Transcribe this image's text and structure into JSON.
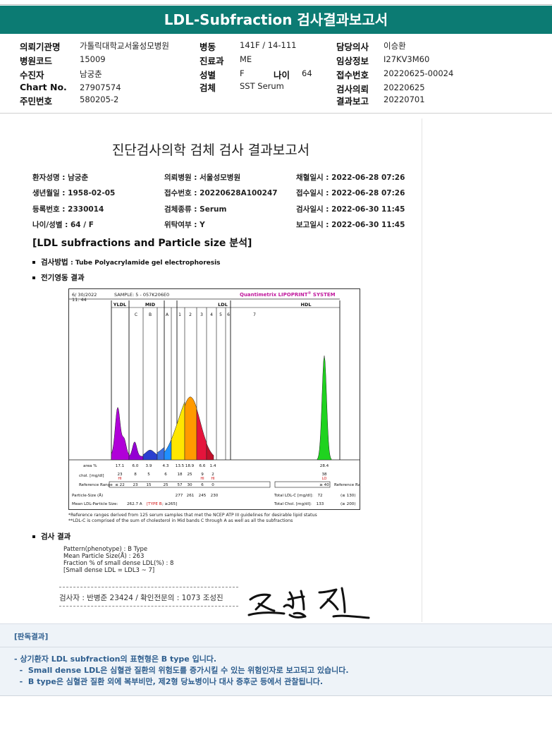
{
  "title": "LDL-Subfraction 검사결과보고서",
  "header": {
    "rows": [
      [
        {
          "label": "의뢰기관명",
          "value": "가톨릭대학교서울성모병원"
        },
        {
          "label": "병동",
          "value": "141F / 14-111"
        },
        {
          "label": "담당의사",
          "value": "이승환"
        }
      ],
      [
        {
          "label": "병원코드",
          "value": "15009"
        },
        {
          "label": "진료과",
          "value": "ME"
        },
        {
          "label": "임상정보",
          "value": "I27KV3M60"
        }
      ],
      [
        {
          "label": "수진자",
          "value": "남궁춘"
        },
        {
          "label": "성별",
          "value": "F"
        },
        {
          "label": "접수번호",
          "value": "20220625-00024"
        }
      ],
      [
        {
          "label": "Chart No.",
          "value": "27907574"
        },
        {
          "label": "검체",
          "value": "SST Serum"
        },
        {
          "label": "검사의뢰",
          "value": "20220625"
        }
      ],
      [
        {
          "label": "주민번호",
          "value": "580205-2"
        },
        null,
        {
          "label": "결과보고",
          "value": "20220701"
        }
      ]
    ],
    "age_label": "나이",
    "age_value": "64"
  },
  "report": {
    "title": "진단검사의학 검체 검사 결과보고서",
    "patient_info": [
      [
        "환자성명 : 남궁춘",
        "의뢰병원 : 서울성모병원",
        "채혈일시 : 2022-06-28 07:26"
      ],
      [
        "생년월일 : 1958-02-05",
        "접수번호 : 20220628A100247",
        "접수일시 : 2022-06-28 07:26"
      ],
      [
        "등록번호 : 2330014",
        "검체종류 : Serum",
        "검사일시 : 2022-06-30 11:45"
      ],
      [
        "나이/성별 : 64 / F",
        "위탁여부 :  Y",
        "보고일시 : 2022-06-30 11:45"
      ]
    ],
    "section_title": "[LDL subfractions and Particle size 분석]",
    "method_label": "검사방법",
    "method_value": ": Tube Polyacrylamide gel electrophoresis",
    "electro_label": "전기영동 결과",
    "result_label": "검사 결과",
    "results": [
      "Pattern(phenotype) : B Type",
      "Mean Particle Size(Å) : 263",
      "Fraction % of small dense LDL(%) : 8",
      "[Small dense LDL = LDL3 ~ 7]"
    ],
    "notes": [
      "*Reference ranges derived from 125 serum samples that met the NCEP ATP III guidelines for desirable lipid status",
      "**LDL-C is comprised of the sum of cholesterol in Mid bands C through A as well as all the subfractions"
    ],
    "checker": "검사자 : 반병준  23424  /  확인전문의 : 1073  조성진",
    "signature_text": "조성진"
  },
  "chart_data": {
    "type": "area",
    "date": "6/ 30/2022",
    "time": "11: 44",
    "sample": "SAMPLE:   5 - 057K206E0",
    "brand": "Quantimetrix LIPOPRINT",
    "brand_sup": "®",
    "brand_tail": " SYSTEM",
    "groups": [
      "YLDL",
      "MID",
      "LDL",
      "HDL"
    ],
    "bands": [
      "C",
      "B",
      "A",
      "1",
      "2",
      "3",
      "4",
      "5",
      "6",
      "7"
    ],
    "row_labels": {
      "area": "area %",
      "chol": "chol. [mg/dl]",
      "ref": "Reference Range",
      "ref_right": "Reference Range",
      "size": "Particle-Size (Å)",
      "mean": "Mean LDL-Particle Size:"
    },
    "area_pct": [
      "17.1",
      "6.0",
      "3.9",
      "4.3",
      "13.5",
      "18.9",
      "6.6",
      "1.4"
    ],
    "hdl_area": "28.4",
    "chol": [
      "23",
      "8",
      "5",
      "6",
      "18",
      "25",
      "9",
      "2"
    ],
    "chol_flags": [
      "HI",
      "",
      "",
      "",
      "",
      "",
      "HI",
      "HI"
    ],
    "hdl_chol": "38",
    "hdl_flag": "LO",
    "reference": [
      "≤ 22",
      "23",
      "15",
      "25",
      "57",
      "30",
      "6",
      "0"
    ],
    "hdl_reference": "≥ 40",
    "particle_size": [
      "277",
      "261",
      "245",
      "230"
    ],
    "mean_size_value": "262.7 A",
    "mean_size_type": "[TYPE B",
    "mean_size_ref": "; ≥265]",
    "total_ldl_label": "Total LDL-C [mg/dl]:",
    "total_ldl_value": "72",
    "total_ldl_ref": "(≤ 130)",
    "total_chol_label": "Total Chol. [mg/dl]:",
    "total_chol_value": "133",
    "total_chol_ref": "(≥ 200)"
  },
  "interpretation": {
    "heading": "[판독결과]",
    "lines": [
      "- 상기환자 LDL subfraction의 표현형은 B type 입니다.",
      "  -  Small dense LDL은 심혈관 질환의 위험도를 증가시킬 수 있는 위험인자로 보고되고 있습니다.",
      "  -  B type은 심혈관 질환 외에 복부비만, 제2형 당뇨병이나 대사 증후군 등에서 관찰됩니다."
    ]
  }
}
